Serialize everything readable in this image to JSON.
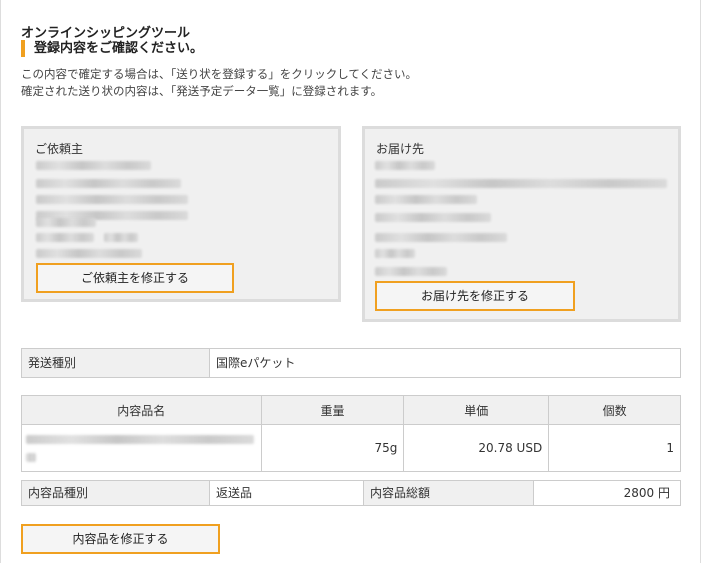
{
  "header": {
    "app_title": "オンラインシッピングツール",
    "subtitle": "登録内容をご確認ください。",
    "description_line1": "この内容で確定する場合は、「送り状を登録する」をクリックしてください。",
    "description_line2": "確定された送り状の内容は、「発送予定データ一覧」に登録されます。"
  },
  "sender": {
    "label": "ご依頼主",
    "edit_button": "ご依頼主を修正する"
  },
  "recipient": {
    "label": "お届け先",
    "edit_button": "お届け先を修正する"
  },
  "shipping": {
    "label": "発送種別",
    "value": "国際eパケット"
  },
  "items_table": {
    "headers": [
      "内容品名",
      "重量",
      "単価",
      "個数"
    ],
    "rows": [
      {
        "name": "",
        "weight": "75g",
        "unit_price": "20.78 USD",
        "quantity": "1"
      }
    ]
  },
  "summary": {
    "type_label": "内容品種別",
    "type_value": "返送品",
    "total_label": "内容品総額",
    "total_value": "2800 円"
  },
  "contents_edit_button": "内容品を修正する",
  "colors": {
    "accent": "#f0a020",
    "panel_bg": "#f0f0f0",
    "border": "#cccccc"
  }
}
